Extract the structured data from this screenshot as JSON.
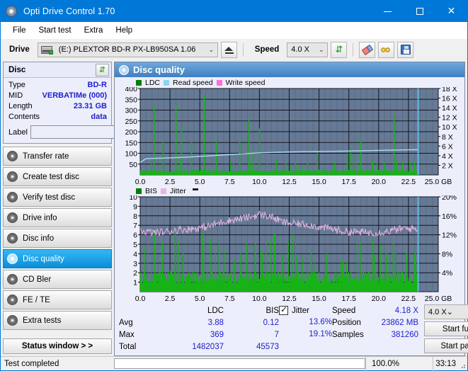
{
  "window": {
    "title": "Opti Drive Control 1.70",
    "icon": "disc-icon",
    "minimize": "–",
    "maximize": "□",
    "close": "✕"
  },
  "menu": {
    "items": [
      "File",
      "Start test",
      "Extra",
      "Help"
    ]
  },
  "toolbar": {
    "drive_label": "Drive",
    "drive_value": "(E:)   PLEXTOR BD-R  PX-LB950SA 1.06",
    "eject_title": "Eject",
    "speed_label": "Speed",
    "speed_value": "4.0 X",
    "refresh_title": "Refresh",
    "erase_title": "Erase",
    "glasses_title": "Glasses",
    "save_title": "Save"
  },
  "disc": {
    "header": "Disc",
    "refresh_button": "⇵",
    "rows": [
      {
        "key": "Type",
        "value": "BD-R"
      },
      {
        "key": "MID",
        "value": "VERBATIMe (000)"
      },
      {
        "key": "Length",
        "value": "23.31 GB"
      },
      {
        "key": "Contents",
        "value": "data"
      }
    ],
    "label_key": "Label",
    "label_value": "",
    "label_placeholder": ""
  },
  "sidebar": {
    "items": [
      {
        "label": "Transfer rate",
        "active": false
      },
      {
        "label": "Create test disc",
        "active": false
      },
      {
        "label": "Verify test disc",
        "active": false
      },
      {
        "label": "Drive info",
        "active": false
      },
      {
        "label": "Disc info",
        "active": false
      },
      {
        "label": "Disc quality",
        "active": true
      },
      {
        "label": "CD Bler",
        "active": false
      },
      {
        "label": "FE / TE",
        "active": false
      },
      {
        "label": "Extra tests",
        "active": false
      }
    ],
    "status_window": "Status window > >"
  },
  "main": {
    "title": "Disc quality"
  },
  "stats": {
    "col_ldc": "LDC",
    "col_bis": "BIS",
    "jitter_label": "Jitter",
    "jitter_checked": true,
    "rows": [
      {
        "name": "Avg",
        "ldc": "3.88",
        "bis": "0.12",
        "jitter": "13.6%"
      },
      {
        "name": "Max",
        "ldc": "369",
        "bis": "7",
        "jitter": "19.1%"
      },
      {
        "name": "Total",
        "ldc": "1482037",
        "bis": "45573",
        "jitter": ""
      }
    ],
    "speed_key": "Speed",
    "speed_value": "4.18 X",
    "position_key": "Position",
    "position_value": "23862 MB",
    "samples_key": "Samples",
    "samples_value": "381260",
    "speed_select": "4.0 X",
    "start_full": "Start full",
    "start_part": "Start part"
  },
  "statusbar": {
    "text": "Test completed",
    "progress": 100,
    "percent": "100.0%",
    "time": "33:13"
  },
  "colors": {
    "accent": "#0078d7",
    "ldc_green": "#16b316",
    "read_speed": "#8fd4ee",
    "write_speed": "#ff6ed6",
    "jitter_pink": "#e8b4e0",
    "plot_bg": "#667a96",
    "panel_bg": "#eceefb"
  },
  "chart_data": [
    {
      "type": "line",
      "title": "LDC / Read speed",
      "xlabel": "GB",
      "ylabel": "LDC",
      "legend": [
        {
          "name": "LDC",
          "color": "#008000"
        },
        {
          "name": "Read speed",
          "color": "#8fd4ee"
        },
        {
          "name": "Write speed",
          "color": "#ff6ed6"
        }
      ],
      "legend_position": "top-left",
      "grid": true,
      "xlim": [
        0,
        25
      ],
      "xticks": [
        "0.0",
        "2.5",
        "5.0",
        "7.5",
        "10.0",
        "12.5",
        "15.0",
        "17.5",
        "20.0",
        "22.5",
        "25.0 GB"
      ],
      "ylim": [
        0,
        400
      ],
      "yticks": [
        400,
        350,
        300,
        250,
        200,
        150,
        100,
        50
      ],
      "y2lim": [
        0,
        18
      ],
      "y2ticks": [
        "18 X",
        "16 X",
        "14 X",
        "12 X",
        "10 X",
        "8 X",
        "6 X",
        "4 X",
        "2 X"
      ],
      "data_end_gb": 23.31,
      "series": [
        {
          "name": "LDC",
          "type": "spike",
          "baseline": 18,
          "spikes": [
            [
              1.15,
              327
            ],
            [
              1.9,
              155
            ],
            [
              2.95,
              325
            ],
            [
              3.45,
              228
            ],
            [
              4.3,
              152
            ],
            [
              5.35,
              370
            ],
            [
              6.35,
              160
            ],
            [
              8.3,
              160
            ],
            [
              9.1,
              255
            ],
            [
              9.45,
              110
            ],
            [
              9.95,
              215
            ],
            [
              11.4,
              70
            ],
            [
              12.2,
              60
            ],
            [
              13.0,
              58
            ],
            [
              14.0,
              62
            ],
            [
              14.85,
              118
            ],
            [
              16.3,
              60
            ],
            [
              17.35,
              100
            ],
            [
              17.6,
              120
            ],
            [
              17.9,
              95
            ],
            [
              18.45,
              168
            ],
            [
              19.4,
              58
            ],
            [
              20.4,
              62
            ],
            [
              21.25,
              275
            ],
            [
              21.5,
              70
            ],
            [
              22.0,
              62
            ],
            [
              22.6,
              64
            ],
            [
              23.0,
              60
            ]
          ]
        },
        {
          "name": "Read speed",
          "type": "line",
          "axis": "right",
          "points": [
            [
              0,
              2.6
            ],
            [
              0.5,
              3.4
            ],
            [
              2,
              3.5
            ],
            [
              4,
              3.7
            ],
            [
              6,
              4.0
            ],
            [
              8,
              4.3
            ],
            [
              10,
              4.6
            ],
            [
              12,
              4.75
            ],
            [
              14,
              4.85
            ],
            [
              16,
              4.9
            ],
            [
              18,
              5.0
            ],
            [
              20,
              5.1
            ],
            [
              22,
              5.2
            ],
            [
              23.31,
              5.25
            ]
          ]
        },
        {
          "name": "Write speed",
          "type": "line",
          "points": []
        }
      ]
    },
    {
      "type": "line",
      "title": "BIS / Jitter",
      "xlabel": "GB",
      "ylabel": "BIS",
      "legend": [
        {
          "name": "BIS",
          "color": "#008000"
        },
        {
          "name": "Jitter",
          "color": "#e8b4e0"
        }
      ],
      "legend_position": "top-left",
      "grid": true,
      "xlim": [
        0,
        25
      ],
      "xticks": [
        "0.0",
        "2.5",
        "5.0",
        "7.5",
        "10.0",
        "12.5",
        "15.0",
        "17.5",
        "20.0",
        "22.5",
        "25.0 GB"
      ],
      "ylim": [
        0,
        10
      ],
      "yticks": [
        10,
        9,
        8,
        7,
        6,
        5,
        4,
        3,
        2,
        1
      ],
      "y2lim": [
        0,
        20
      ],
      "y2ticks": [
        "20%",
        "16%",
        "12%",
        "8%",
        "4%"
      ],
      "data_end_gb": 23.31,
      "series": [
        {
          "name": "BIS",
          "type": "spike",
          "baseline": 1.6,
          "spikes": [
            [
              1.2,
              6.2
            ],
            [
              1.85,
              5.2
            ],
            [
              2.9,
              6.1
            ],
            [
              3.15,
              5.3
            ],
            [
              3.55,
              4.1
            ],
            [
              5.2,
              6.3
            ],
            [
              5.3,
              5.1
            ],
            [
              6.6,
              5.0
            ],
            [
              7.9,
              3.4
            ],
            [
              8.9,
              5.1
            ],
            [
              9.6,
              5.1
            ],
            [
              10.2,
              4.2
            ],
            [
              11.9,
              4.0
            ],
            [
              13.1,
              3.9
            ],
            [
              14.3,
              4.0
            ],
            [
              15.6,
              4.0
            ],
            [
              17.0,
              3.5
            ],
            [
              18.4,
              5.2
            ],
            [
              19.6,
              3.9
            ],
            [
              20.6,
              4.1
            ],
            [
              21.2,
              5.1
            ],
            [
              21.4,
              4.2
            ],
            [
              22.3,
              4.1
            ],
            [
              23.0,
              4.0
            ]
          ]
        },
        {
          "name": "Jitter",
          "type": "line",
          "axis": "right",
          "points": [
            [
              0,
              12.9
            ],
            [
              1,
              12.5
            ],
            [
              2,
              12.6
            ],
            [
              3,
              13.0
            ],
            [
              4,
              13.2
            ],
            [
              5,
              13.4
            ],
            [
              6,
              14.0
            ],
            [
              7,
              14.8
            ],
            [
              8,
              15.2
            ],
            [
              9,
              15.6
            ],
            [
              10,
              16.3
            ],
            [
              11,
              15.8
            ],
            [
              12,
              14.6
            ],
            [
              13,
              14.3
            ],
            [
              14,
              14.2
            ],
            [
              15,
              13.6
            ],
            [
              16,
              13.3
            ],
            [
              17,
              12.7
            ],
            [
              18,
              12.6
            ],
            [
              19,
              12.5
            ],
            [
              20,
              12.5
            ],
            [
              21,
              12.8
            ],
            [
              22,
              13.3
            ],
            [
              23.31,
              13.3
            ]
          ]
        }
      ]
    }
  ]
}
